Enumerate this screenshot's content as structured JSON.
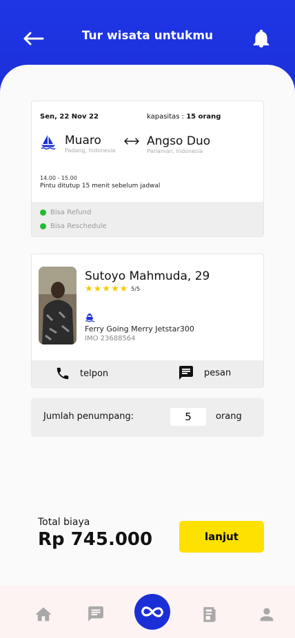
{
  "header": {
    "title": "Tur wisata untukmu"
  },
  "trip": {
    "date": "Sen, 22 Nov 22",
    "capacity_label": "kapasitas : ",
    "capacity_value": "15 orang",
    "origin": "Muaro",
    "origin_region": "Padang, Indonesia",
    "destination": "Angso Duo",
    "destination_region": "Pariaman, Indonesia",
    "time": "14.00 - 15.00",
    "note": "Pintu ditutup 15 menit sebelum jadwal",
    "policies": [
      "Bisa Refund",
      "Bisa Reschedule"
    ]
  },
  "captain": {
    "name": "Sutoyo Mahmuda, 29",
    "rating": "5/5",
    "stars": 5,
    "ship_name": "Ferry Going Merry Jetstar300",
    "imo": "IMO 23688564",
    "call_label": "telpon",
    "message_label": "pesan"
  },
  "passengers": {
    "label": "Jumlah penumpang:",
    "count": "5",
    "unit": "orang"
  },
  "summary": {
    "total_label": "Total biaya",
    "total_amount": "Rp 745.000",
    "next_label": "lanjut"
  },
  "bottom_nav": {
    "items": [
      "home-icon",
      "chat-icon",
      "infinity-icon",
      "ticket-icon",
      "profile-icon"
    ]
  },
  "colors": {
    "primary": "#1b2fd6",
    "accent": "#ffe100",
    "success": "#22bb33",
    "star": "#f4cb00"
  }
}
